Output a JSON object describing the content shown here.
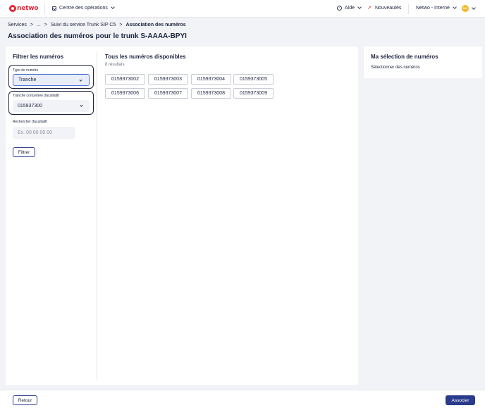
{
  "header": {
    "brand": "netwo",
    "nav_ops": "Centre des opérations",
    "help": "Aide",
    "news": "Nouveautés",
    "account": "Netwo - Interne",
    "avatar_initials": "NO"
  },
  "breadcrumb": [
    "Services",
    "...",
    "Suivi du service Trunk SIP C5",
    "Association des numéros"
  ],
  "page_title": "Association des numéros pour le trunk S-AAAA-BPYI",
  "filter": {
    "title": "Filtrer les numéros",
    "type_label": "Type de numéro",
    "type_value": "Tranche",
    "tranche_label": "Tranche concernée (facultatif)",
    "tranche_value": "015937300",
    "search_label": "Rechercher (facultatif)",
    "search_placeholder": "Ex. 00 00 00 00",
    "filter_button": "Filtrer"
  },
  "available": {
    "title": "Tous les numéros disponibles",
    "count": "8 résultats",
    "numbers": [
      "0159373002",
      "0159373003",
      "0159373004",
      "0159373005",
      "0159373006",
      "0159373007",
      "0159373008",
      "0159373009"
    ]
  },
  "selection": {
    "title": "Ma sélection de numéros",
    "hint": "Sélectionner des numéros"
  },
  "footer": {
    "back": "Retour",
    "submit": "Associer"
  },
  "colors": {
    "brand": "#e8263a",
    "primary": "#2a3a8c",
    "accent": "#4b6fd6"
  }
}
